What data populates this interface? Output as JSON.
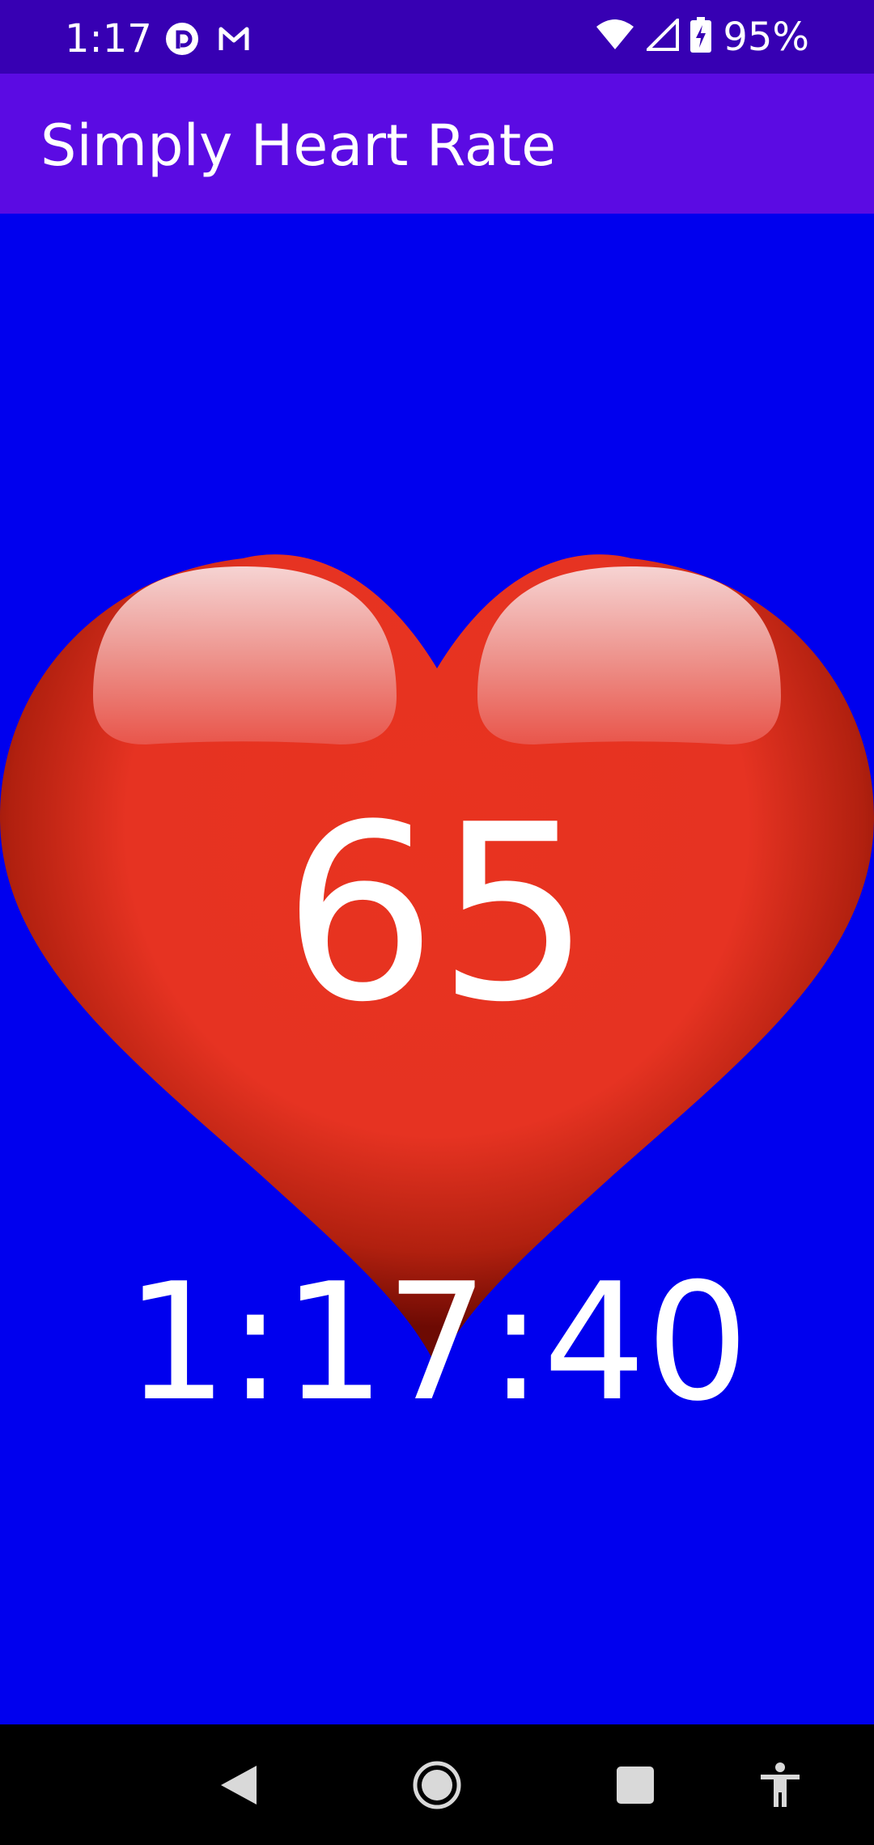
{
  "status_bar": {
    "time": "1:17",
    "left_icons": [
      "pocket-casts-icon",
      "gmail-icon"
    ],
    "right_icons": [
      "wifi-icon",
      "cell-signal-icon",
      "battery-charging-icon"
    ],
    "battery": "95%"
  },
  "app_bar": {
    "title": "Simply Heart Rate"
  },
  "main": {
    "heart_rate": "65",
    "clock": "1:17:40",
    "background_color": "#0000ee",
    "heart_color": "#e8331f"
  },
  "nav_bar": {
    "buttons": [
      "back-icon",
      "home-icon",
      "recents-icon",
      "accessibility-icon"
    ]
  }
}
